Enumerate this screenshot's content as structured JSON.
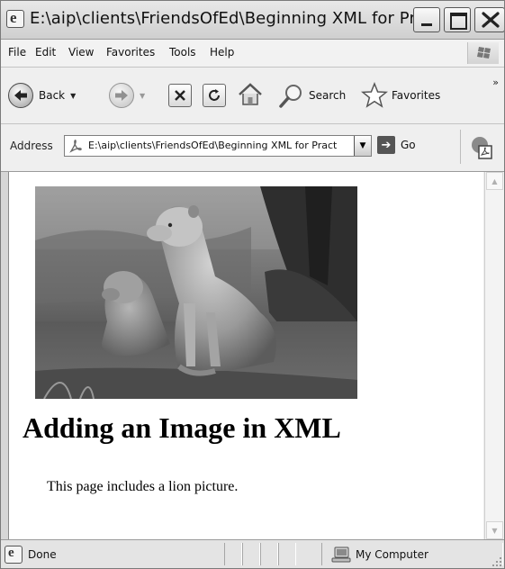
{
  "window": {
    "title": "E:\\aip\\clients\\FriendsOfEd\\Beginning XML for Pr..."
  },
  "menu": {
    "items": [
      "File",
      "Edit",
      "View",
      "Favorites",
      "Tools",
      "Help"
    ]
  },
  "toolbar": {
    "back_label": "Back",
    "search_label": "Search",
    "favorites_label": "Favorites",
    "chevron": "»"
  },
  "address": {
    "label": "Address",
    "url": "E:\\aip\\clients\\FriendsOfEd\\Beginning XML for Pract",
    "go_label": "Go"
  },
  "page": {
    "heading": "Adding an Image in XML",
    "paragraph": "This page includes a lion picture."
  },
  "status": {
    "text": "Done",
    "zone": "My Computer"
  },
  "icons": {
    "app": "ie-icon",
    "back": "back-arrow-icon",
    "forward": "forward-arrow-icon",
    "stop": "stop-icon",
    "refresh": "refresh-icon",
    "home": "home-icon",
    "search": "magnifier-icon",
    "favorites": "star-icon",
    "go": "go-arrow-icon",
    "zone": "computer-icon"
  }
}
